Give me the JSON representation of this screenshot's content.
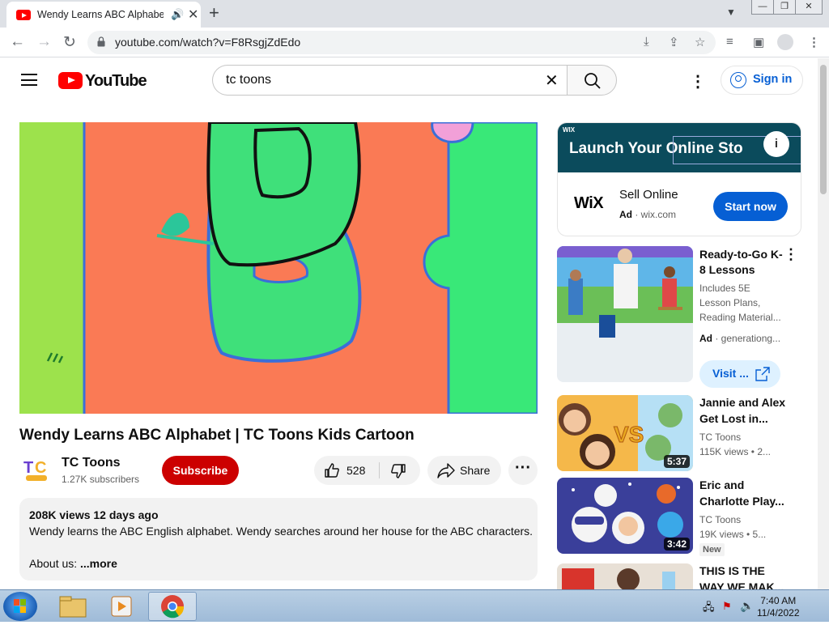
{
  "browser": {
    "tab_title": "Wendy Learns ABC Alphabet",
    "url": "youtube.com/watch?v=F8RsgjZdEdo"
  },
  "youtube": {
    "logo_text": "YouTube",
    "search_query": "tc toons",
    "sign_in": "Sign in"
  },
  "video": {
    "title": "Wendy Learns ABC Alphabet | TC Toons Kids Cartoon",
    "channel": "TC Toons",
    "subscribers": "1.27K subscribers",
    "subscribe_label": "Subscribe",
    "likes": "528",
    "share_label": "Share",
    "description": {
      "views_date": "208K views  12 days ago",
      "text": "Wendy learns the ABC English alphabet. Wendy searches around her house for the ABC characters.",
      "about": "About us:",
      "more": "...more"
    }
  },
  "ad": {
    "banner_brand": "WIX",
    "headline": "Launch Your  Online Sto",
    "brand_logo": "WiX",
    "title": "Sell Online",
    "ad_label": "Ad",
    "domain": "· wix.com",
    "cta": "Start now"
  },
  "recommendations": [
    {
      "title": "Ready-to-Go K-8 Lessons",
      "line1": "Includes 5E",
      "line2": "Lesson Plans,",
      "line3": "Reading Material...",
      "ad_label": "Ad",
      "advertiser": "· generationg...",
      "cta": "Visit ..."
    },
    {
      "title_line1": "Jannie and Alex",
      "title_line2": "Get Lost in...",
      "channel": "TC Toons",
      "meta": "115K views  • 2...",
      "duration": "5:37"
    },
    {
      "title_line1": "Eric and",
      "title_line2": "Charlotte Play...",
      "channel": "TC Toons",
      "meta": "19K views  • 5...",
      "badge": "New",
      "duration": "3:42"
    },
    {
      "title_line1": "THIS IS THE",
      "title_line2": "WAY WE MAK..."
    }
  ],
  "taskbar": {
    "time": "7:40 AM",
    "date": "11/4/2022"
  },
  "colors": {
    "youtube_red": "#ff0000",
    "subscribe_red": "#cc0000",
    "link_blue": "#065fd4",
    "ad_banner": "#0b4b5c"
  }
}
